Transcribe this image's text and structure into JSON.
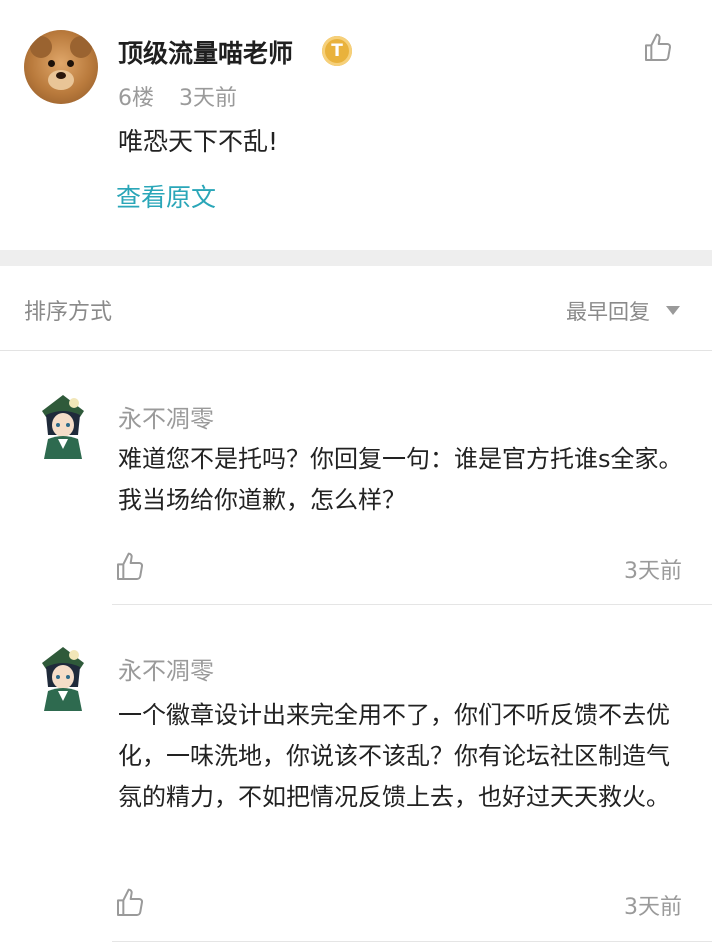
{
  "post": {
    "author": "顶级流量喵老师",
    "badge": "T",
    "floor": "6楼",
    "time": "3天前",
    "content": "唯恐天下不乱!",
    "view_original": "查看原文"
  },
  "sort": {
    "label": "排序方式",
    "value": "最早回复"
  },
  "replies": [
    {
      "name": "永不凋零",
      "content": "难道您不是托吗？你回复一句：谁是官方托谁s全家。我当场给你道歉，怎么样？",
      "time": "3天前"
    },
    {
      "name": "永不凋零",
      "content": "一个徽章设计出来完全用不了，你们不听反馈不去优化，一味洗地，你说该不该乱？你有论坛社区制造气氛的精力，不如把情况反馈上去，也好过天天救火。",
      "time": "3天前"
    }
  ],
  "colors": {
    "link": "#2aa6b8",
    "muted": "#9a9a9a",
    "badge": "#e9b23c"
  },
  "icons": {
    "like": "thumbs-up-icon",
    "sort": "triangle-down-icon"
  }
}
